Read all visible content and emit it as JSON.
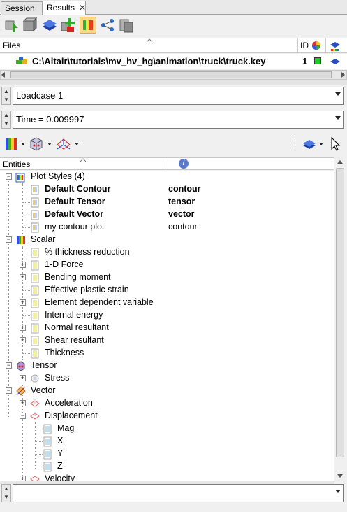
{
  "tabs": [
    {
      "label": "Session",
      "active": false
    },
    {
      "label": "Results",
      "active": true,
      "close_glyph": "✕"
    }
  ],
  "toolbar_icons": [
    "import-icon",
    "box-icon",
    "layer-icon",
    "add-green-icon",
    "contour-icon",
    "graph-icon",
    "cylinder-icon"
  ],
  "files": {
    "header_label": "Files",
    "id_label": "ID",
    "row_path": "C:\\Altair\\tutorials\\mv_hv_hg\\animation\\truck\\truck.key",
    "row_id": "1"
  },
  "loadcase": {
    "value": "Loadcase 1"
  },
  "time": {
    "value": "Time = 0.009997"
  },
  "entities": {
    "header_label": "Entities",
    "info_glyph": "i"
  },
  "tree": {
    "plot_styles": {
      "label": "Plot Styles (4)"
    },
    "ps_rows": [
      {
        "label": "Default Contour",
        "type": "contour"
      },
      {
        "label": "Default Tensor",
        "type": "tensor"
      },
      {
        "label": "Default Vector",
        "type": "vector"
      },
      {
        "label": "my contour plot",
        "type": "contour"
      }
    ],
    "scalar": {
      "label": "Scalar"
    },
    "scalar_rows": [
      {
        "label": "% thickness reduction",
        "exp": false
      },
      {
        "label": "1-D Force",
        "exp": true
      },
      {
        "label": "Bending moment",
        "exp": true
      },
      {
        "label": "Effective plastic strain",
        "exp": false
      },
      {
        "label": "Element dependent variable",
        "exp": true
      },
      {
        "label": "Internal energy",
        "exp": false
      },
      {
        "label": "Normal resultant",
        "exp": true
      },
      {
        "label": "Shear resultant",
        "exp": true
      },
      {
        "label": "Thickness",
        "exp": false
      }
    ],
    "tensor": {
      "label": "Tensor"
    },
    "stress": {
      "label": "Stress"
    },
    "vector": {
      "label": "Vector"
    },
    "acceleration": {
      "label": "Acceleration"
    },
    "displacement": {
      "label": "Displacement"
    },
    "disp_rows": [
      {
        "label": "Mag"
      },
      {
        "label": "X"
      },
      {
        "label": "Y"
      },
      {
        "label": "Z"
      }
    ],
    "velocity": {
      "label": "Velocity"
    }
  },
  "bottom_combo": {
    "value": ""
  }
}
